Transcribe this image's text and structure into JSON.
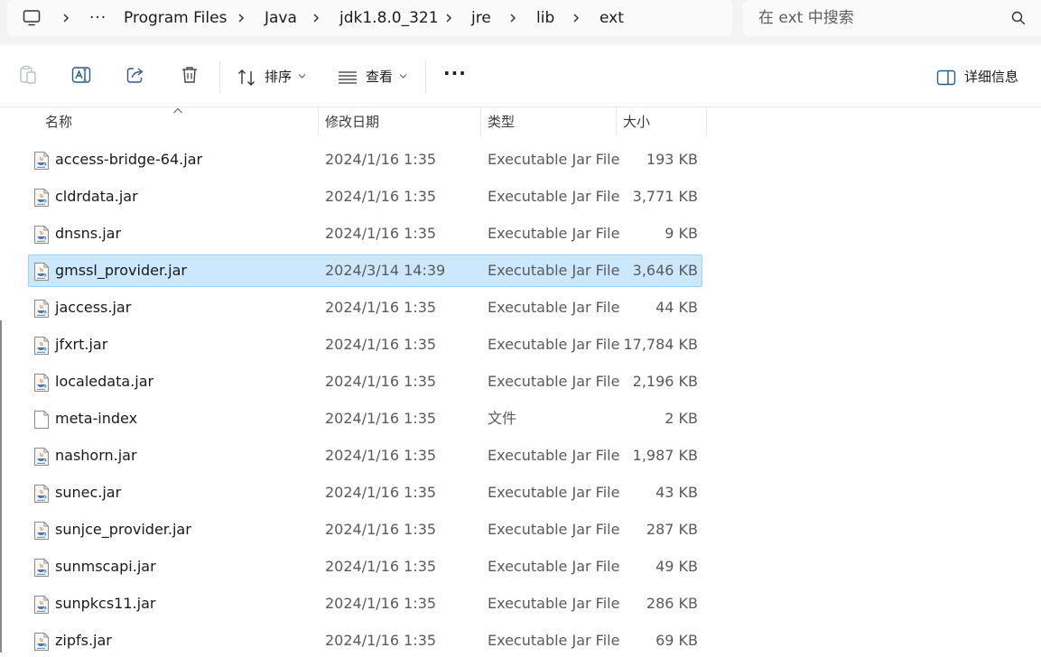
{
  "breadcrumb": {
    "more": "···",
    "items": [
      "Program Files",
      "Java",
      "jdk1.8.0_321",
      "jre",
      "lib",
      "ext"
    ]
  },
  "search": {
    "placeholder": "在 ext 中搜索"
  },
  "toolbar": {
    "sort_label": "排序",
    "view_label": "查看",
    "more_label": "···",
    "details_label": "详细信息"
  },
  "columns": {
    "name": "名称",
    "date": "修改日期",
    "type": "类型",
    "size": "大小"
  },
  "files": [
    {
      "name": "access-bridge-64.jar",
      "date": "2024/1/16 1:35",
      "type": "Executable Jar File",
      "size": "193 KB",
      "icon": "jar-file-icon"
    },
    {
      "name": "cldrdata.jar",
      "date": "2024/1/16 1:35",
      "type": "Executable Jar File",
      "size": "3,771 KB",
      "icon": "jar-file-icon"
    },
    {
      "name": "dnsns.jar",
      "date": "2024/1/16 1:35",
      "type": "Executable Jar File",
      "size": "9 KB",
      "icon": "jar-file-icon"
    },
    {
      "name": "gmssl_provider.jar",
      "date": "2024/3/14 14:39",
      "type": "Executable Jar File",
      "size": "3,646 KB",
      "icon": "jar-file-icon",
      "selected": true
    },
    {
      "name": "jaccess.jar",
      "date": "2024/1/16 1:35",
      "type": "Executable Jar File",
      "size": "44 KB",
      "icon": "jar-file-icon"
    },
    {
      "name": "jfxrt.jar",
      "date": "2024/1/16 1:35",
      "type": "Executable Jar File",
      "size": "17,784 KB",
      "icon": "jar-file-icon"
    },
    {
      "name": "localedata.jar",
      "date": "2024/1/16 1:35",
      "type": "Executable Jar File",
      "size": "2,196 KB",
      "icon": "jar-file-icon"
    },
    {
      "name": "meta-index",
      "date": "2024/1/16 1:35",
      "type": "文件",
      "size": "2 KB",
      "icon": "blank-file-icon"
    },
    {
      "name": "nashorn.jar",
      "date": "2024/1/16 1:35",
      "type": "Executable Jar File",
      "size": "1,987 KB",
      "icon": "jar-file-icon"
    },
    {
      "name": "sunec.jar",
      "date": "2024/1/16 1:35",
      "type": "Executable Jar File",
      "size": "43 KB",
      "icon": "jar-file-icon"
    },
    {
      "name": "sunjce_provider.jar",
      "date": "2024/1/16 1:35",
      "type": "Executable Jar File",
      "size": "287 KB",
      "icon": "jar-file-icon"
    },
    {
      "name": "sunmscapi.jar",
      "date": "2024/1/16 1:35",
      "type": "Executable Jar File",
      "size": "49 KB",
      "icon": "jar-file-icon"
    },
    {
      "name": "sunpkcs11.jar",
      "date": "2024/1/16 1:35",
      "type": "Executable Jar File",
      "size": "286 KB",
      "icon": "jar-file-icon"
    },
    {
      "name": "zipfs.jar",
      "date": "2024/1/16 1:35",
      "type": "Executable Jar File",
      "size": "69 KB",
      "icon": "jar-file-icon"
    }
  ],
  "colors": {
    "selection_bg": "#cce8ff",
    "selection_border": "#99d1ff",
    "accent": "#0067c0"
  }
}
